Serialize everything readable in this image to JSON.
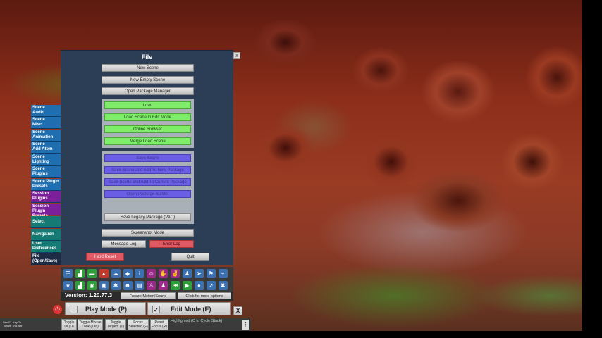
{
  "panel": {
    "title": "File",
    "close_label": "x",
    "buttons": {
      "new_scene": "New Scene",
      "new_empty_scene": "New Empty Scene",
      "open_package_manager": "Open Package Manager",
      "load": "Load",
      "load_edit_mode": "Load Scene in Edit Mode",
      "online_browser": "Online Browser",
      "merge_load": "Merge Load Scene",
      "save_scene": "Save Scene",
      "save_new_package": "Save Scene and Add To New Package",
      "save_current_package": "Save Scene and Add To Current Package",
      "open_package_builder": "Open Package Builder",
      "save_legacy": "Save Legacy Package (VAC)",
      "screenshot_mode": "Screenshot Mode",
      "message_log": "Message Log",
      "error_log": "Error Log",
      "hard_reset": "Hard Reset",
      "quit": "Quit"
    }
  },
  "categories": [
    {
      "line1": "Scene",
      "line2": "Audio"
    },
    {
      "line1": "Scene",
      "line2": "Misc"
    },
    {
      "line1": "Scene",
      "line2": "Animation"
    },
    {
      "line1": "Scene",
      "line2": "Add Atom"
    },
    {
      "line1": "Scene",
      "line2": "Lighting"
    },
    {
      "line1": "Scene",
      "line2": "Plugins"
    },
    {
      "line1": "Scene Plugin",
      "line2": "Presets"
    },
    {
      "line1": "Session",
      "line2": "Plugins"
    },
    {
      "line1": "Session Plugin",
      "line2": "Presets"
    },
    {
      "line1": "Select",
      "line2": ""
    },
    {
      "line1": "Navigation",
      "line2": ""
    },
    {
      "line1": "User",
      "line2": "Preferences"
    },
    {
      "line1": "File",
      "line2": "(Open/Save)"
    }
  ],
  "status": {
    "version": "Version: 1.20.77.3",
    "freeze": "Freeze Motion/Sound",
    "more_options": "Click for more options"
  },
  "modes": {
    "play": "Play Mode (P)",
    "edit": "Edit Mode (E)",
    "edit_check": "✓",
    "close": "X"
  },
  "bottom_bar": {
    "hint_line1": "Use F1 Key To",
    "hint_line2": "Toggle This Bar",
    "toggle_ui_1": "Toggle",
    "toggle_ui_2": "UI (U)",
    "toggle_mouse_1": "Toggle Mouse",
    "toggle_mouse_2": "Look (Tab)",
    "toggle_targets_1": "Toggle",
    "toggle_targets_2": "Targets (T)",
    "focus_selected_1": "Focus",
    "focus_selected_2": "Selected (F)",
    "reset_focus_1": "Reset",
    "reset_focus_2": "Focus (R)",
    "highlighted": "Highlighted (C to Cycle Stack)"
  },
  "colors": {
    "panel_bg": "#2c3d56",
    "green": "#7fed6a",
    "blue": "#6a5fe4",
    "red": "#e05a66",
    "category_blue": "#1f6fb0",
    "category_purple": "#7c1f9a"
  },
  "toolbar_icons_row1": [
    {
      "name": "menu-icon",
      "glyph": "☰",
      "color": "#3a6fb0"
    },
    {
      "name": "open-file-icon",
      "glyph": "▟",
      "color": "#2e9e3a"
    },
    {
      "name": "folder-icon",
      "glyph": "▬",
      "color": "#2e9e3a"
    },
    {
      "name": "save-icon",
      "glyph": "▲",
      "color": "#c0392b"
    },
    {
      "name": "cloud-icon",
      "glyph": "☁",
      "color": "#3a6fb0"
    },
    {
      "name": "cube-icon",
      "glyph": "◆",
      "color": "#3a6fb0"
    },
    {
      "name": "info-icon",
      "glyph": "i",
      "color": "#3a6fb0"
    },
    {
      "name": "person-add-icon",
      "glyph": "☺",
      "color": "#9b2a8a"
    },
    {
      "name": "hand-icon",
      "glyph": "✋",
      "color": "#9b2a8a"
    },
    {
      "name": "hand-move-icon",
      "glyph": "✌",
      "color": "#9b2a8a"
    },
    {
      "name": "person-icon",
      "glyph": "♟",
      "color": "#3a6fb0"
    },
    {
      "name": "share-icon",
      "glyph": "➤",
      "color": "#3a6fb0"
    },
    {
      "name": "flag-icon",
      "glyph": "⚑",
      "color": "#3a6fb0"
    },
    {
      "name": "plus-icon",
      "glyph": "+",
      "color": "#3a6fb0"
    }
  ],
  "toolbar_icons_row2": [
    {
      "name": "star-icon",
      "glyph": "★",
      "color": "#3a6fb0"
    },
    {
      "name": "chart-icon",
      "glyph": "▟",
      "color": "#2e9e3a"
    },
    {
      "name": "camera-icon",
      "glyph": "◉",
      "color": "#2e9e3a"
    },
    {
      "name": "screenshot-icon",
      "glyph": "▣",
      "color": "#3a6fb0"
    },
    {
      "name": "network-icon",
      "glyph": "✱",
      "color": "#3a6fb0"
    },
    {
      "name": "mask-icon",
      "glyph": "☻",
      "color": "#3a6fb0"
    },
    {
      "name": "document-icon",
      "glyph": "▤",
      "color": "#3a6fb0"
    },
    {
      "name": "user-icon",
      "glyph": "♙",
      "color": "#9b2a8a"
    },
    {
      "name": "users-icon",
      "glyph": "♟",
      "color": "#9b2a8a"
    },
    {
      "name": "skip-back-icon",
      "glyph": "⏮",
      "color": "#2e9e3a"
    },
    {
      "name": "play-icon",
      "glyph": "▶",
      "color": "#2e9e3a"
    },
    {
      "name": "record-icon",
      "glyph": "●",
      "color": "#3a6fb0"
    },
    {
      "name": "pointer-icon",
      "glyph": "➚",
      "color": "#3a6fb0"
    },
    {
      "name": "tools-icon",
      "glyph": "✖",
      "color": "#3a6fb0"
    }
  ]
}
